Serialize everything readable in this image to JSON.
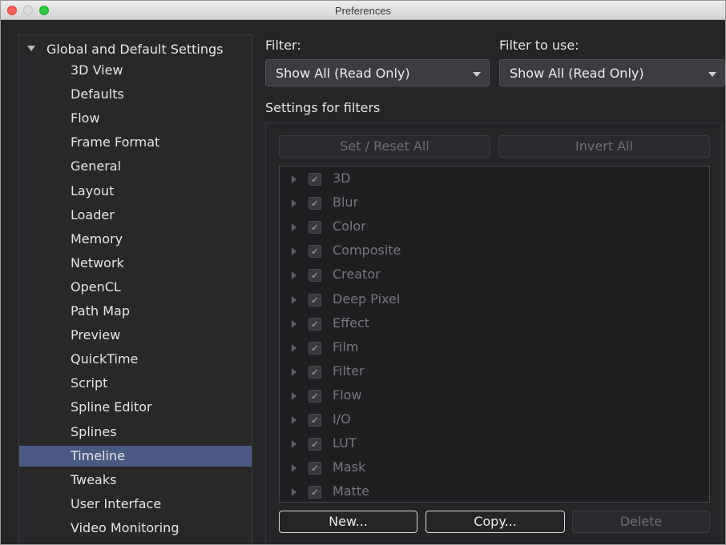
{
  "window": {
    "title": "Preferences"
  },
  "sidebar": {
    "root_label": "Global and Default Settings",
    "items": [
      "3D View",
      "Defaults",
      "Flow",
      "Frame Format",
      "General",
      "Layout",
      "Loader",
      "Memory",
      "Network",
      "OpenCL",
      "Path Map",
      "Preview",
      "QuickTime",
      "Script",
      "Spline Editor",
      "Splines",
      "Timeline",
      "Tweaks",
      "User Interface",
      "Video Monitoring"
    ],
    "selected": "Timeline"
  },
  "filter": {
    "label": "Filter:",
    "value": "Show All (Read Only)"
  },
  "filter_to_use": {
    "label": "Filter to use:",
    "value": "Show All (Read Only)"
  },
  "settings": {
    "heading": "Settings for filters",
    "set_reset_label": "Set / Reset All",
    "invert_label": "Invert All",
    "check_glyph": "✓",
    "items": [
      "3D",
      "Blur",
      "Color",
      "Composite",
      "Creator",
      "Deep Pixel",
      "Effect",
      "Film",
      "Filter",
      "Flow",
      "I/O",
      "LUT",
      "Mask",
      "Matte"
    ]
  },
  "actions": {
    "new_label": "New...",
    "copy_label": "Copy...",
    "delete_label": "Delete"
  },
  "colors": {
    "selection": "#4b5a85",
    "background": "#252528"
  }
}
